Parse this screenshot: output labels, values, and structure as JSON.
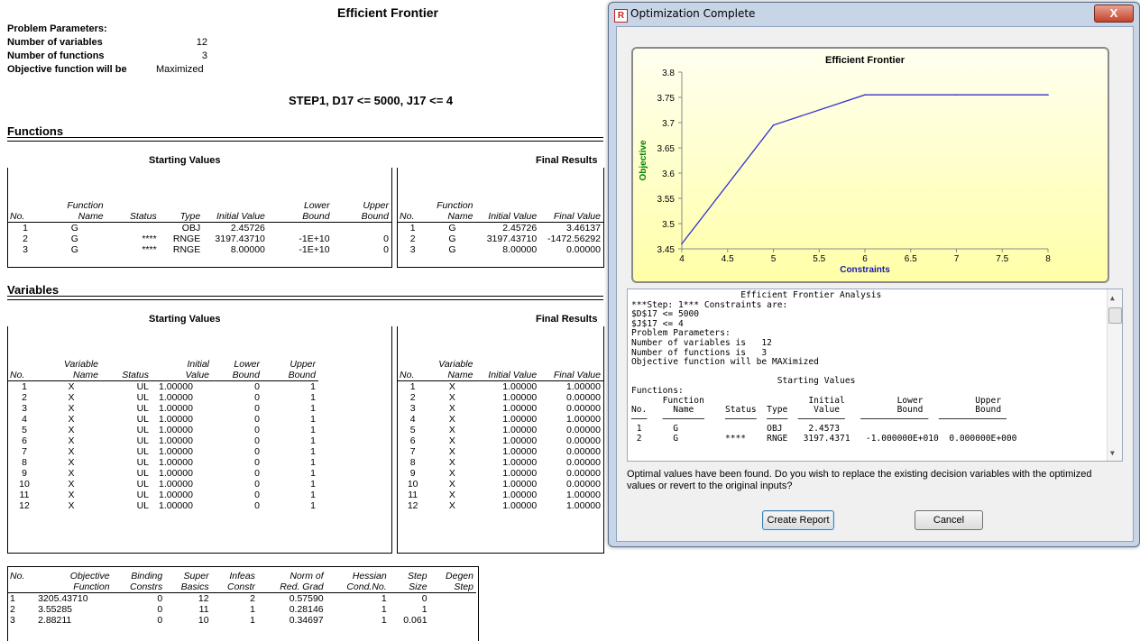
{
  "report": {
    "title": "Efficient Frontier",
    "params_heading": "Problem Parameters:",
    "params": [
      {
        "label": "Number of variables",
        "value": "12"
      },
      {
        "label": "Number of functions",
        "value": "3"
      },
      {
        "label": "Objective function will be",
        "value": "Maximized"
      }
    ],
    "step_title": "STEP1, D17 <= 5000, J17 <= 4",
    "functions_title": "Functions",
    "variables_title": "Variables",
    "starting_values": "Starting Values",
    "final_results": "Final Results",
    "func_start_headers": {
      "no": "No.",
      "fn1": "Function",
      "fn2": "Name",
      "status": "Status",
      "type": "Type",
      "init": "Initial Value",
      "lb1": "Lower",
      "lb2": "Bound",
      "ub1": "Upper",
      "ub2": "Bound"
    },
    "func_final_headers": {
      "no": "No.",
      "fn1": "Function",
      "fn2": "Name",
      "init": "Initial Value",
      "fin": "Final Value"
    },
    "functions_start": [
      [
        "1",
        "G",
        "",
        "OBJ",
        "2.45726",
        "",
        ""
      ],
      [
        "2",
        "G",
        "****",
        "RNGE",
        "3197.43710",
        "-1E+10",
        "0"
      ],
      [
        "3",
        "G",
        "****",
        "RNGE",
        "8.00000",
        "-1E+10",
        "0"
      ]
    ],
    "functions_final": [
      [
        "1",
        "G",
        "2.45726",
        "3.46137"
      ],
      [
        "2",
        "G",
        "3197.43710",
        "-1472.56292"
      ],
      [
        "3",
        "G",
        "8.00000",
        "0.00000"
      ]
    ],
    "var_start_headers": {
      "no": "No.",
      "v1": "Variable",
      "v2": "Name",
      "status": "Status",
      "i1": "Initial",
      "i2": "Value",
      "lb1": "Lower",
      "lb2": "Bound",
      "ub1": "Upper",
      "ub2": "Bound"
    },
    "var_final_headers": {
      "no": "No.",
      "v1": "Variable",
      "v2": "Name",
      "init": "Initial Value",
      "fin": "Final Value"
    },
    "variables_start": [
      [
        "1",
        "X",
        "UL",
        "1.00000",
        "0",
        "1"
      ],
      [
        "2",
        "X",
        "UL",
        "1.00000",
        "0",
        "1"
      ],
      [
        "3",
        "X",
        "UL",
        "1.00000",
        "0",
        "1"
      ],
      [
        "4",
        "X",
        "UL",
        "1.00000",
        "0",
        "1"
      ],
      [
        "5",
        "X",
        "UL",
        "1.00000",
        "0",
        "1"
      ],
      [
        "6",
        "X",
        "UL",
        "1.00000",
        "0",
        "1"
      ],
      [
        "7",
        "X",
        "UL",
        "1.00000",
        "0",
        "1"
      ],
      [
        "8",
        "X",
        "UL",
        "1.00000",
        "0",
        "1"
      ],
      [
        "9",
        "X",
        "UL",
        "1.00000",
        "0",
        "1"
      ],
      [
        "10",
        "X",
        "UL",
        "1.00000",
        "0",
        "1"
      ],
      [
        "11",
        "X",
        "UL",
        "1.00000",
        "0",
        "1"
      ],
      [
        "12",
        "X",
        "UL",
        "1.00000",
        "0",
        "1"
      ]
    ],
    "variables_final": [
      [
        "1",
        "X",
        "1.00000",
        "1.00000"
      ],
      [
        "2",
        "X",
        "1.00000",
        "0.00000"
      ],
      [
        "3",
        "X",
        "1.00000",
        "0.00000"
      ],
      [
        "4",
        "X",
        "1.00000",
        "1.00000"
      ],
      [
        "5",
        "X",
        "1.00000",
        "0.00000"
      ],
      [
        "6",
        "X",
        "1.00000",
        "0.00000"
      ],
      [
        "7",
        "X",
        "1.00000",
        "0.00000"
      ],
      [
        "8",
        "X",
        "1.00000",
        "0.00000"
      ],
      [
        "9",
        "X",
        "1.00000",
        "0.00000"
      ],
      [
        "10",
        "X",
        "1.00000",
        "0.00000"
      ],
      [
        "11",
        "X",
        "1.00000",
        "1.00000"
      ],
      [
        "12",
        "X",
        "1.00000",
        "1.00000"
      ]
    ],
    "iter_headers": [
      [
        "No.",
        ""
      ],
      [
        "Objective",
        "Function"
      ],
      [
        "Binding",
        "Constrs"
      ],
      [
        "Super",
        "Basics"
      ],
      [
        "Infeas",
        "Constr"
      ],
      [
        "Norm of",
        "Red. Grad"
      ],
      [
        "Hessian",
        "Cond.No."
      ],
      [
        "Step",
        "Size"
      ],
      [
        "Degen",
        "Step"
      ]
    ],
    "iterations": [
      [
        "1",
        "3205.43710",
        "0",
        "12",
        "2",
        "0.57590",
        "1",
        "0",
        ""
      ],
      [
        "2",
        "3.55285",
        "0",
        "11",
        "1",
        "0.28146",
        "1",
        "1",
        ""
      ],
      [
        "3",
        "2.88211",
        "0",
        "10",
        "1",
        "0.34697",
        "1",
        "0.061",
        ""
      ]
    ]
  },
  "dialog": {
    "title": "Optimization Complete",
    "icon": "R",
    "close_label": "X",
    "message": "Optimal values have been found. Do you wish to replace the existing decision variables with the optimized values or revert to the original inputs?",
    "create_report_label": "Create Report",
    "cancel_label": "Cancel",
    "log_text": "                     Efficient Frontier Analysis\n***Step: 1*** Constraints are:\n$D$17 <= 5000\n$J$17 <= 4\nProblem Parameters:\nNumber of variables is   12\nNumber of functions is   3\nObjective function will be MAXimized\n\n                            Starting Values\nFunctions:\n      Function                    Initial          Lower          Upper\nNo.     Name      Status  Type     Value           Bound          Bound\n───   ────────    ──────  ────  ─────────   ─────────────  ─────────────\n 1      G                 OBJ     2.4573\n 2      G         ****    RNGE   3197.4371   -1.000000E+010  0.000000E+000"
  },
  "chart_data": {
    "type": "line",
    "title": "Efficient Frontier",
    "xlabel": "Constraints",
    "ylabel": "Objective",
    "x": [
      4,
      5,
      6,
      7,
      8
    ],
    "values": [
      3.46,
      3.695,
      3.755,
      3.755,
      3.755
    ],
    "xlim": [
      4,
      8
    ],
    "ylim": [
      3.45,
      3.8
    ],
    "xticks": [
      "4",
      "4.5",
      "5",
      "5.5",
      "6",
      "6.5",
      "7",
      "7.5",
      "8"
    ],
    "yticks": [
      "3.45",
      "3.5",
      "3.55",
      "3.6",
      "3.65",
      "3.7",
      "3.75",
      "3.8"
    ],
    "line_color": "#3333cc",
    "title_color": "#000000",
    "label_color": "#1a1aa6",
    "ylabel_color": "#008000"
  }
}
